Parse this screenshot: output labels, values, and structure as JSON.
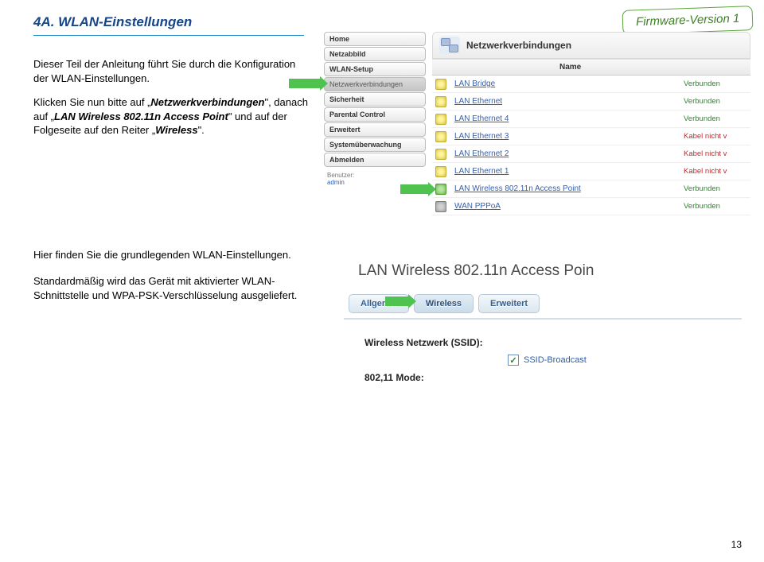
{
  "doc": {
    "section_title": "4A. WLAN-Einstellungen",
    "firmware_badge": "Firmware-Version 1",
    "para1": "Dieser Teil der Anleitung führt Sie durch die Konfiguration der WLAN-Einstellungen.",
    "para2_p1": "Klicken Sie nun bitte auf „",
    "para2_b1": "Netzwerkverbindungen",
    "para2_p2": "\", danach auf „",
    "para2_b2": "LAN Wireless 802.11n Access Point",
    "para2_p3": "\" und auf der Folgeseite auf den Reiter „",
    "para2_b3": "Wireless",
    "para2_p4": "\".",
    "para3": "Hier finden Sie die grundlegenden WLAN-Einstellungen.",
    "para4": "Standardmäßig wird das Gerät mit aktivierter WLAN-Schnittstelle und WPA-PSK-Verschlüsselung ausgeliefert.",
    "page_number": "13"
  },
  "shot1": {
    "sidebar": {
      "items": [
        "Home",
        "Netzabbild",
        "WLAN-Setup",
        "Netzwerkverbindungen",
        "Sicherheit",
        "Parental Control",
        "Erweitert",
        "Systemüberwachung",
        "Abmelden"
      ],
      "user_label": "Benutzer:",
      "user_name": "admin"
    },
    "header_title": "Netzwerkverbindungen",
    "table": {
      "col_name": "Name",
      "rows": [
        {
          "icon": "lan",
          "name": "LAN Bridge",
          "status": "Verbunden",
          "ok": true
        },
        {
          "icon": "lan",
          "name": "LAN Ethernet",
          "status": "Verbunden",
          "ok": true
        },
        {
          "icon": "lan",
          "name": "LAN Ethernet 4",
          "status": "Verbunden",
          "ok": true
        },
        {
          "icon": "lan",
          "name": "LAN Ethernet 3",
          "status": "Kabel nicht v",
          "ok": false
        },
        {
          "icon": "lan",
          "name": "LAN Ethernet 2",
          "status": "Kabel nicht v",
          "ok": false
        },
        {
          "icon": "lan",
          "name": "LAN Ethernet 1",
          "status": "Kabel nicht v",
          "ok": false
        },
        {
          "icon": "wlan",
          "name": "LAN Wireless 802.11n Access Point",
          "status": "Verbunden",
          "ok": true
        },
        {
          "icon": "wan",
          "name": "WAN PPPoA",
          "status": "Verbunden",
          "ok": true
        }
      ]
    }
  },
  "shot2": {
    "title": "LAN Wireless 802.11n Access Poin",
    "tabs": [
      "Allgemei",
      "Wireless",
      "Erweitert"
    ],
    "ssid_label": "Wireless Netzwerk (SSID):",
    "ssid_broadcast": "SSID-Broadcast",
    "mode_label": "802,11 Mode:"
  }
}
